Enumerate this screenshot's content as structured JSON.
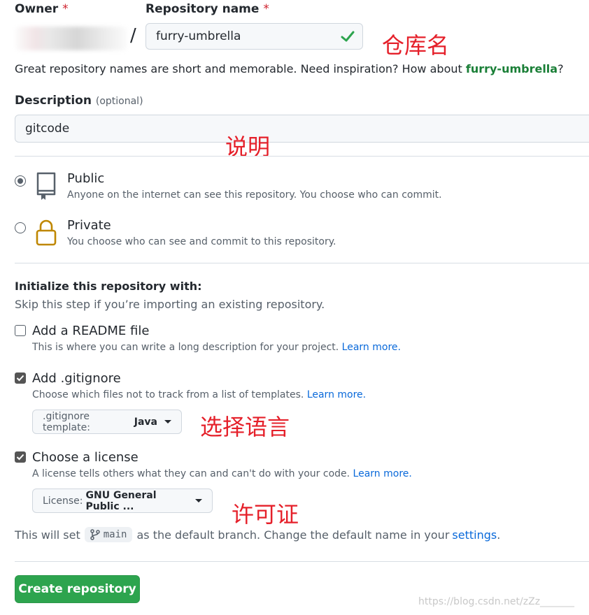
{
  "owner": {
    "label": "Owner",
    "required_mark": "*"
  },
  "slash": "/",
  "repo": {
    "label": "Repository name",
    "required_mark": "*",
    "value": "furry-umbrella"
  },
  "annotations": {
    "repo_name": "仓库名",
    "description": "说明",
    "gitignore": "选择语言",
    "license": "许可证"
  },
  "hint": {
    "prefix": "Great repository names are short and memorable. Need inspiration? How about ",
    "suggestion": "furry-umbrella",
    "suffix": "?"
  },
  "description": {
    "label": "Description",
    "optional": "(optional)",
    "value": "gitcode"
  },
  "visibility": {
    "public": {
      "title": "Public",
      "desc": "Anyone on the internet can see this repository. You choose who can commit."
    },
    "private": {
      "title": "Private",
      "desc": "You choose who can see and commit to this repository."
    }
  },
  "init": {
    "title": "Initialize this repository with:",
    "subtitle": "Skip this step if you’re importing an existing repository."
  },
  "readme": {
    "title": "Add a README file",
    "desc": "This is where you can write a long description for your project.",
    "link": "Learn more."
  },
  "gitignore": {
    "title": "Add .gitignore",
    "desc": "Choose which files not to track from a list of templates.",
    "link": "Learn more.",
    "select_prefix": ".gitignore template:",
    "select_value": "Java"
  },
  "license": {
    "title": "Choose a license",
    "desc": "A license tells others what they can and can't do with your code.",
    "link": "Learn more.",
    "select_prefix": "License:",
    "select_value": "GNU General Public ..."
  },
  "branch": {
    "prefix": "This will set",
    "name": "main",
    "middle": "as the default branch. Change the default name in your",
    "link": "settings",
    "suffix": "."
  },
  "create_button": "Create repository",
  "watermark": "https://blog.csdn.net/zZz_______",
  "colors": {
    "accent_green": "#2da44e",
    "link_blue": "#0969da",
    "annotation_red": "#e5202a"
  }
}
